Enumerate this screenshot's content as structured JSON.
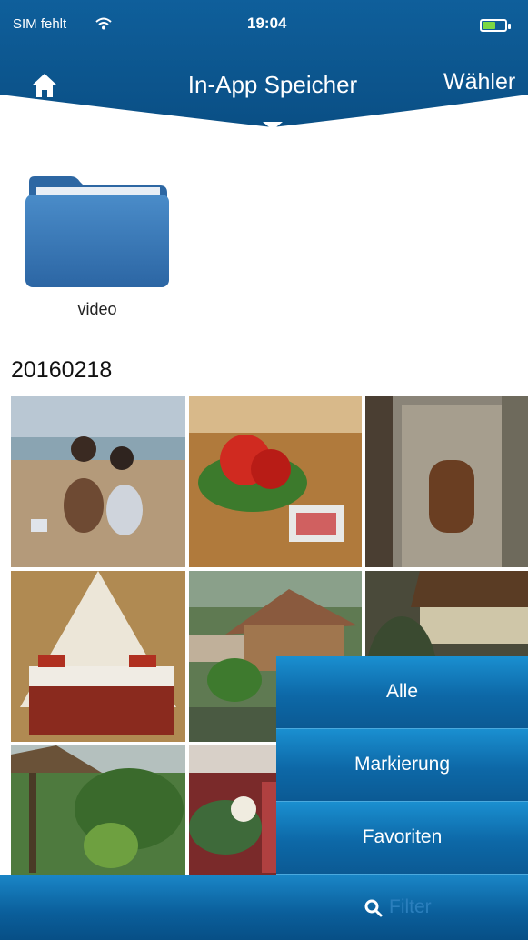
{
  "status_bar": {
    "carrier": "SIM fehlt",
    "time": "19:04"
  },
  "nav": {
    "title": "In-App Speicher",
    "select_label": "Wähler"
  },
  "folder": {
    "label": "video"
  },
  "section": {
    "date": "20160218"
  },
  "photos": [
    "beach-children",
    "red-hibiscus",
    "stone-shrine",
    "canopy-bed",
    "temple-garden",
    "pavilion-roof",
    "jungle-hut",
    "flower-offering"
  ],
  "filter_menu": {
    "items": [
      "Alle",
      "Markierung",
      "Favoriten"
    ]
  },
  "bottom_bar": {
    "filter_placeholder": "Filter"
  },
  "colors": {
    "nav_blue": "#0c5a94",
    "menu_blue": "#0d68a7",
    "folder_blue": "#3a79b8"
  }
}
